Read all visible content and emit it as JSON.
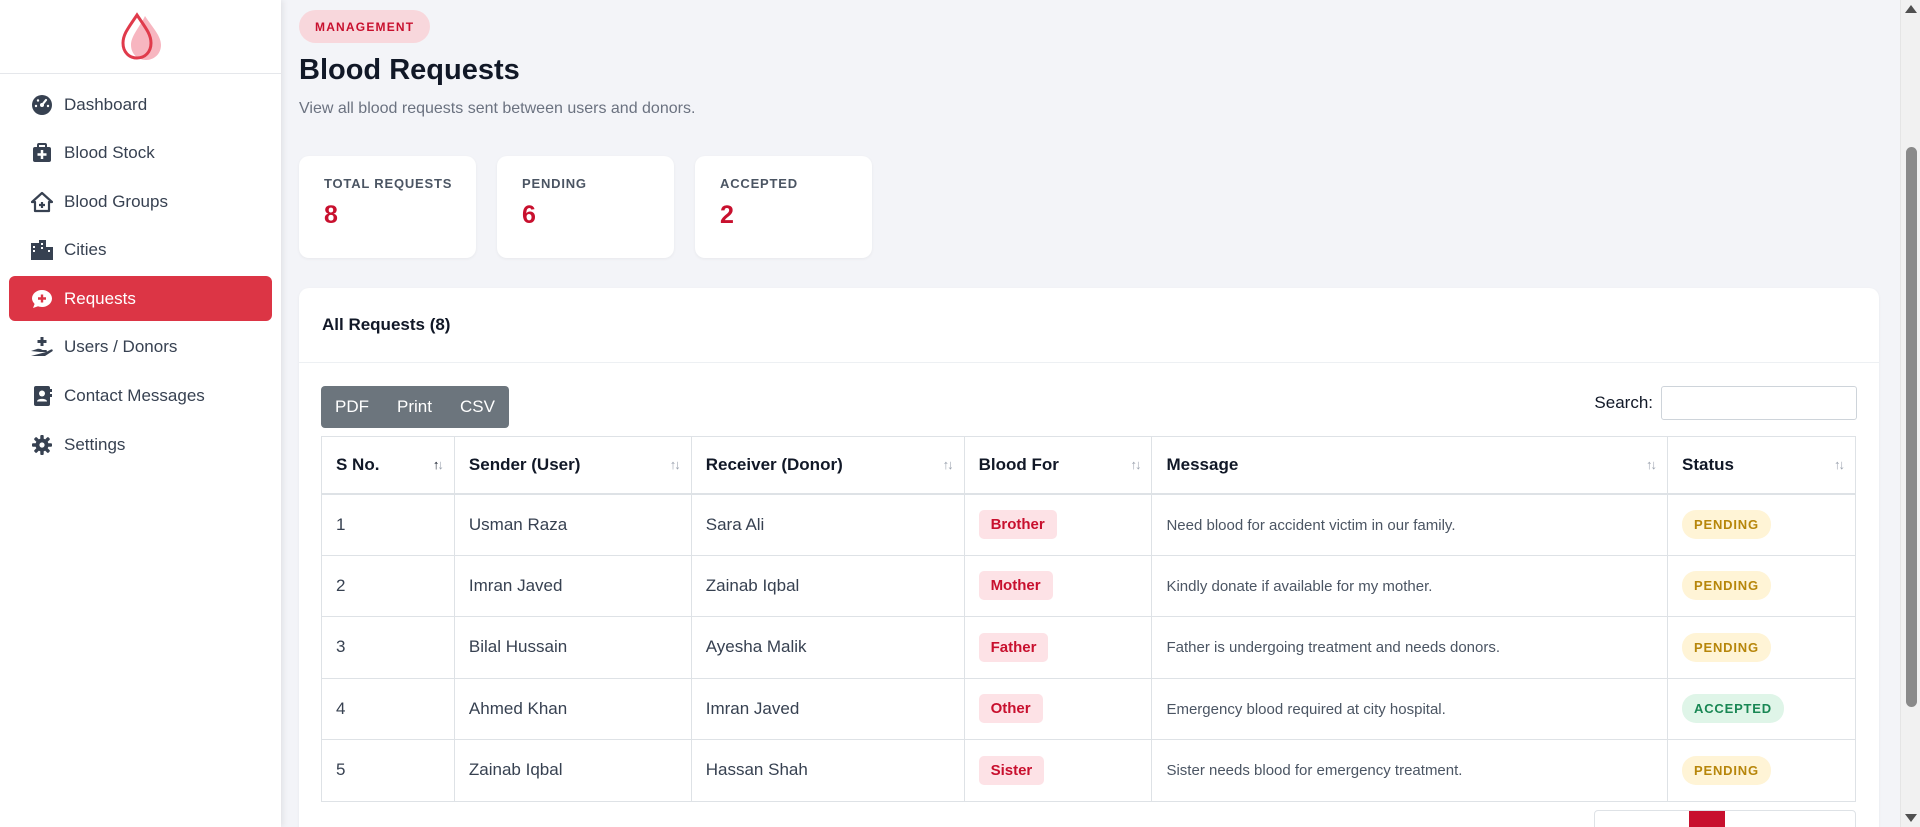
{
  "sidebar": {
    "items": [
      {
        "label": "Dashboard",
        "icon": "dashboard-gauge-icon"
      },
      {
        "label": "Blood Stock",
        "icon": "medical-kit-icon"
      },
      {
        "label": "Blood Groups",
        "icon": "house-medical-icon"
      },
      {
        "label": "Cities",
        "icon": "city-buildings-icon"
      },
      {
        "label": "Requests",
        "icon": "comment-medical-icon"
      },
      {
        "label": "Users / Donors",
        "icon": "hand-holding-medical-icon"
      },
      {
        "label": "Contact Messages",
        "icon": "address-book-icon"
      },
      {
        "label": "Settings",
        "icon": "gear-icon"
      }
    ],
    "active_index": 4
  },
  "header": {
    "badge": "MANAGEMENT",
    "title": "Blood Requests",
    "subtitle": "View all blood requests sent between users and donors."
  },
  "stats": [
    {
      "label": "TOTAL REQUESTS",
      "value": "8"
    },
    {
      "label": "PENDING",
      "value": "6"
    },
    {
      "label": "ACCEPTED",
      "value": "2"
    }
  ],
  "card": {
    "title": "All Requests (8)",
    "buttons": {
      "pdf": "PDF",
      "print": "Print",
      "csv": "CSV"
    },
    "search_label": "Search:",
    "search_value": ""
  },
  "table": {
    "columns": [
      "S No.",
      "Sender (User)",
      "Receiver (Donor)",
      "Blood For",
      "Message",
      "Status"
    ],
    "rows": [
      {
        "sno": "1",
        "sender": "Usman Raza",
        "receiver": "Sara Ali",
        "blood_for": "Brother",
        "message": "Need blood for accident victim in our family.",
        "status": "PENDING"
      },
      {
        "sno": "2",
        "sender": "Imran Javed",
        "receiver": "Zainab Iqbal",
        "blood_for": "Mother",
        "message": "Kindly donate if available for my mother.",
        "status": "PENDING"
      },
      {
        "sno": "3",
        "sender": "Bilal Hussain",
        "receiver": "Ayesha Malik",
        "blood_for": "Father",
        "message": "Father is undergoing treatment and needs donors.",
        "status": "PENDING"
      },
      {
        "sno": "4",
        "sender": "Ahmed Khan",
        "receiver": "Imran Javed",
        "blood_for": "Other",
        "message": "Emergency blood required at city hospital.",
        "status": "ACCEPTED"
      },
      {
        "sno": "5",
        "sender": "Zainab Iqbal",
        "receiver": "Hassan Shah",
        "blood_for": "Sister",
        "message": "Sister needs blood for emergency treatment.",
        "status": "PENDING"
      }
    ]
  },
  "colors": {
    "accent": "#dc3545",
    "brand_text": "#c8102e",
    "pending_bg": "#fff4d6",
    "accepted_bg": "#dff5e8"
  }
}
